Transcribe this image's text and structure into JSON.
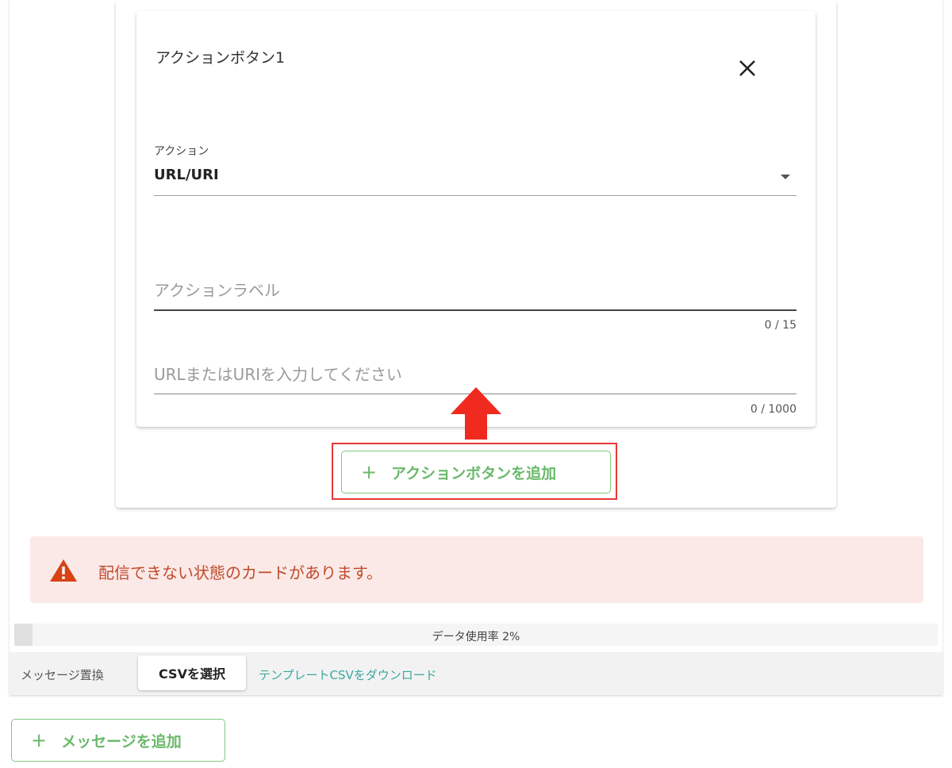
{
  "action_card": {
    "title": "アクションボタン1",
    "action_select": {
      "label": "アクション",
      "value": "URL/URI"
    },
    "label_input": {
      "placeholder": "アクションラベル",
      "counter": "0 / 15"
    },
    "url_input": {
      "placeholder": "URLまたはURIを入力してください",
      "counter": "0 / 1000"
    }
  },
  "add_action_button": {
    "icon": "plus-icon",
    "label": "アクションボタンを追加"
  },
  "alert": {
    "icon": "warning-icon",
    "text": "配信できない状態のカードがあります。"
  },
  "usage": {
    "label": "データ使用率 2%",
    "percent": 2
  },
  "footer": {
    "label": "メッセージ置換",
    "csv_button": "CSVを選択",
    "template_link": "テンプレートCSVをダウンロード"
  },
  "add_message_button": {
    "icon": "plus-icon",
    "label": "メッセージを追加"
  },
  "colors": {
    "accent_green": "#6ab96a",
    "alert_background": "#fbe9e7",
    "alert_text": "#c04a2c",
    "highlight_red": "#e53935",
    "link_teal": "#3aa8a0"
  }
}
